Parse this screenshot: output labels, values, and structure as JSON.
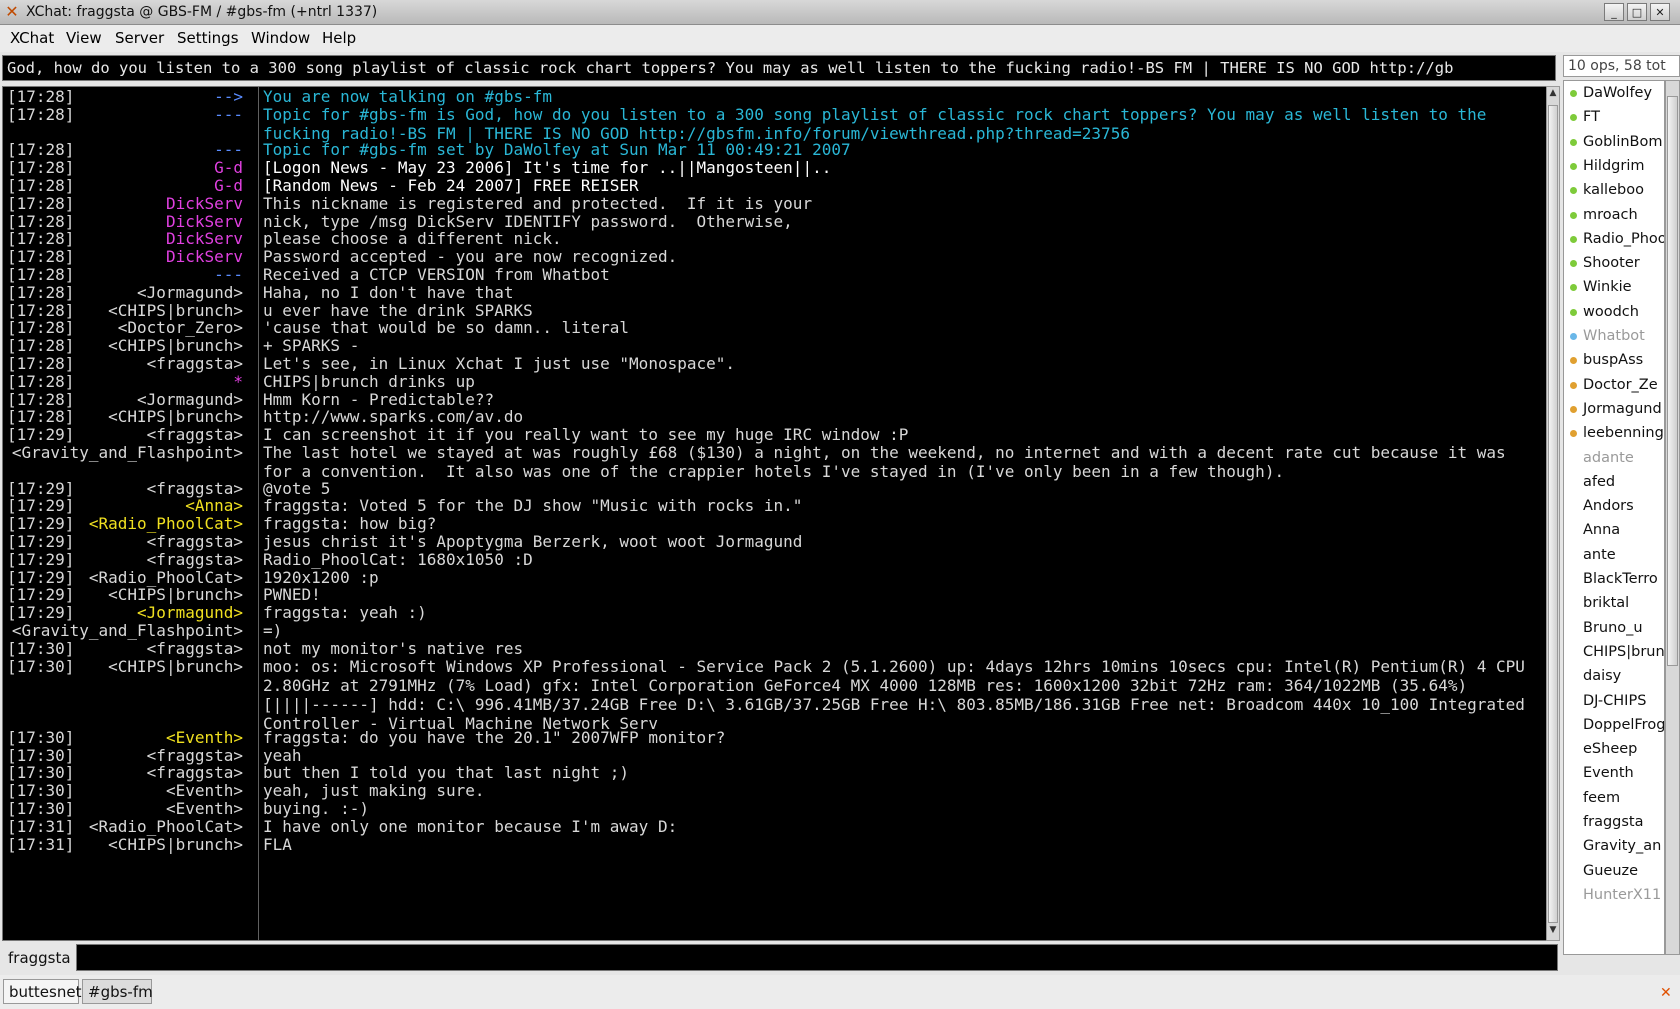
{
  "window": {
    "title": "XChat: fraggsta @ GBS-FM / #gbs-fm (+ntrl 1337)",
    "controls": [
      "_",
      "□",
      "✕"
    ]
  },
  "menu": [
    "XChat",
    "View",
    "Server",
    "Settings",
    "Window",
    "Help"
  ],
  "topic_bar": {
    "text": "God, how do you listen to a 300 song playlist of classic rock chart toppers? You may as well listen to the fucking radio!-BS FM | THERE IS NO GOD http://gb"
  },
  "user_list": {
    "header": "10 ops, 58 tot",
    "users": [
      {
        "name": "DaWolfey",
        "status": "op"
      },
      {
        "name": "FT",
        "status": "op"
      },
      {
        "name": "GoblinBom",
        "status": "op"
      },
      {
        "name": "Hildgrim",
        "status": "op"
      },
      {
        "name": "kalleboo",
        "status": "op"
      },
      {
        "name": "mroach",
        "status": "op"
      },
      {
        "name": "Radio_Phoo",
        "status": "op"
      },
      {
        "name": "Shooter",
        "status": "op"
      },
      {
        "name": "Winkie",
        "status": "op"
      },
      {
        "name": "woodch",
        "status": "op"
      },
      {
        "name": "Whatbot",
        "status": "halfop-away"
      },
      {
        "name": "buspAss",
        "status": "voice"
      },
      {
        "name": "Doctor_Ze",
        "status": "voice"
      },
      {
        "name": "Jormagund",
        "status": "voice"
      },
      {
        "name": "leebenning",
        "status": "voice"
      },
      {
        "name": "adante",
        "status": "away"
      },
      {
        "name": "afed",
        "status": "none"
      },
      {
        "name": "Andors",
        "status": "none"
      },
      {
        "name": "Anna",
        "status": "none"
      },
      {
        "name": "ante",
        "status": "none"
      },
      {
        "name": "BlackTerro",
        "status": "none"
      },
      {
        "name": "briktal",
        "status": "none"
      },
      {
        "name": "Bruno_u",
        "status": "none"
      },
      {
        "name": "CHIPS|brun",
        "status": "none"
      },
      {
        "name": "daisy",
        "status": "none"
      },
      {
        "name": "DJ-CHIPS",
        "status": "none"
      },
      {
        "name": "DoppelFrog",
        "status": "none"
      },
      {
        "name": "eSheep",
        "status": "none"
      },
      {
        "name": "Eventh",
        "status": "none"
      },
      {
        "name": "feem",
        "status": "none"
      },
      {
        "name": "fraggsta",
        "status": "none"
      },
      {
        "name": "Gravity_an",
        "status": "none"
      },
      {
        "name": "Gueuze",
        "status": "none"
      },
      {
        "name": "HunterX11",
        "status": "away"
      }
    ]
  },
  "colors": {
    "op": "#7ecb3a",
    "voice": "#e0a030",
    "halfop": "#6ab7e8",
    "away_text": "#9a9a9a",
    "chan": "#2ab7d6",
    "server": "#5a8cff",
    "magenta": "#e040e0",
    "yellow": "#f0e020",
    "highlight_bg": "#f0a000"
  },
  "chat": [
    {
      "ts": "[17:28]",
      "nick": "-->",
      "nc": "server",
      "msg": "You are now talking on #gbs-fm",
      "mc": "chan"
    },
    {
      "ts": "[17:28]",
      "nick": "---",
      "nc": "server",
      "msg": "Topic for #gbs-fm is God, how do you listen to a 300 song playlist of classic rock chart toppers? You may as well listen to the fucking radio!-BS FM | THERE IS NO GOD http://gbsfm.info/forum/viewthread.php?thread=23756",
      "mc": "chan",
      "rows": 2
    },
    {
      "ts": "[17:28]",
      "nick": "---",
      "nc": "server",
      "msg": "Topic for #gbs-fm set by DaWolfey at Sun Mar 11 00:49:21 2007",
      "mc": "chan"
    },
    {
      "ts": "[17:28]",
      "nick": "G-d",
      "nc": "magenta",
      "msg": "[Logon News - May 23 2006] It's time for ..||Mangosteen||..",
      "mc": "white"
    },
    {
      "ts": "[17:28]",
      "nick": "G-d",
      "nc": "magenta",
      "msg": "[Random News - Feb 24 2007] FREE REISER",
      "mc": "white"
    },
    {
      "ts": "[17:28]",
      "nick": "DickServ",
      "nc": "magenta",
      "msg": "This nickname is registered and protected.  If it is your"
    },
    {
      "ts": "[17:28]",
      "nick": "DickServ",
      "nc": "magenta",
      "msg": "nick, type /msg DickServ IDENTIFY password.  Otherwise,"
    },
    {
      "ts": "[17:28]",
      "nick": "DickServ",
      "nc": "magenta",
      "msg": "please choose a different nick."
    },
    {
      "ts": "[17:28]",
      "nick": "DickServ",
      "nc": "magenta",
      "msg": "Password accepted - you are now recognized."
    },
    {
      "ts": "[17:28]",
      "nick": "---",
      "nc": "server",
      "msg": "Received a CTCP VERSION from Whatbot"
    },
    {
      "ts": "[17:28]",
      "nick": "<Jormagund>",
      "nc": "plain",
      "msg": "Haha, no I don't have that"
    },
    {
      "ts": "[17:28]",
      "nick": "<CHIPS|brunch>",
      "nc": "plain",
      "msg": "u ever have the drink SPARKS"
    },
    {
      "ts": "[17:28]",
      "nick": "<Doctor_Zero>",
      "nc": "plain",
      "msg": "'cause that would be so damn.. literal"
    },
    {
      "ts": "[17:28]",
      "nick": "<CHIPS|brunch>",
      "nc": "plain",
      "msg": "+ SPARKS -"
    },
    {
      "ts": "[17:28]",
      "nick": "<fraggsta>",
      "nc": "plain",
      "msg": "Let's see, in Linux Xchat I just use \"Monospace\"."
    },
    {
      "ts": "[17:28]",
      "nick": "*",
      "nc": "magenta",
      "msg": "CHIPS|brunch drinks up"
    },
    {
      "ts": "[17:28]",
      "nick": "<Jormagund>",
      "nc": "plain",
      "msg": "Hmm Korn - Predictable??"
    },
    {
      "ts": "[17:28]",
      "nick": "<CHIPS|brunch>",
      "nc": "plain",
      "msg": "http://www.sparks.com/av.do"
    },
    {
      "ts": "[17:29]",
      "nick": "<fraggsta>",
      "nc": "plain",
      "msg": "I can screenshot it if you really want to see my huge IRC window :P"
    },
    {
      "ts": "",
      "nick": "<Gravity_and_Flashpoint>",
      "nc": "plain",
      "msg": "The last hotel we stayed at was roughly £68 ($130) a night, on the weekend, no internet and with a decent rate cut because it was for a convention.  It also was one of the crappier hotels I've stayed in (I've only been in a few though).",
      "rows": 2
    },
    {
      "ts": "[17:29]",
      "nick": "<fraggsta>",
      "nc": "plain",
      "msg": "@vote 5"
    },
    {
      "ts": "[17:29]",
      "nick": "<Anna>",
      "nc": "yellow",
      "msg": "fraggsta: Voted 5 for the DJ show \"Music with rocks in.\""
    },
    {
      "ts": "[17:29]",
      "nick": "<Radio_PhoolCat>",
      "nc": "yellow",
      "msg": "fraggsta: how big?"
    },
    {
      "ts": "[17:29]",
      "nick": "<fraggsta>",
      "nc": "plain",
      "msg": "jesus christ it's Apoptygma Berzerk, woot woot Jormagund"
    },
    {
      "ts": "[17:29]",
      "nick": "<fraggsta>",
      "nc": "plain",
      "msg": "Radio_PhoolCat: 1680x1050 :D"
    },
    {
      "ts": "[17:29]",
      "nick": "<Radio_PhoolCat>",
      "nc": "plain",
      "msg": "1920x1200 :p"
    },
    {
      "ts": "[17:29]",
      "nick": "<CHIPS|brunch>",
      "nc": "plain",
      "msg": "PWNED!"
    },
    {
      "ts": "[17:29]",
      "nick": "<Jormagund>",
      "nc": "yellow",
      "msg": "fraggsta: yeah :)"
    },
    {
      "ts": "",
      "nick": "<Gravity_and_Flashpoint>",
      "nc": "plain",
      "msg": "=)"
    },
    {
      "ts": "[17:30]",
      "nick": "<fraggsta>",
      "nc": "plain",
      "msg": "not my monitor's native res"
    },
    {
      "ts": "[17:30]",
      "nick": "<CHIPS|brunch>",
      "nc": "plain",
      "msg": "moo: os: Microsoft Windows XP Professional - Service Pack 2 (5.1.2600) up: 4days 12hrs 10mins 10secs cpu: Intel(R) Pentium(R) 4 CPU 2.80GHz at 2791MHz (7% Load) gfx: Intel Corporation GeForce4 MX 4000 128MB res: 1600x1200 32bit 72Hz ram: 364/1022MB (35.64%) [||||------] hdd: C:\\ 996.41MB/37.24GB Free D:\\ 3.61GB/37.25GB Free H:\\ 803.85MB/186.31GB Free net: Broadcom 440x 10_100 Integrated Controller - Virtual Machine Network Serv",
      "rows": 4
    },
    {
      "ts": "[17:30]",
      "nick": "<Eventh>",
      "nc": "yellow",
      "msg": "fraggsta: do you have the 20.1\" 2007WFP monitor?"
    },
    {
      "ts": "[17:30]",
      "nick": "<fraggsta>",
      "nc": "plain",
      "msg": "yeah"
    },
    {
      "ts": "[17:30]",
      "nick": "<fraggsta>",
      "nc": "plain",
      "msg": "but then I told you that last night ;)"
    },
    {
      "ts": "[17:30]",
      "nick": "<Eventh>",
      "nc": "plain",
      "msg": "yeah, just making sure."
    },
    {
      "ts": "[17:30]",
      "nick": "<Eventh>",
      "nc": "plain",
      "msg": "buying. :-)"
    },
    {
      "ts": "[17:31]",
      "nick": "<Radio_PhoolCat>",
      "nc": "plain",
      "msg": "I have only one monitor because I'm away D:"
    },
    {
      "ts": "[17:31]",
      "nick": "<CHIPS|brunch>",
      "nc": "plain",
      "msg": "FLA"
    }
  ],
  "input": {
    "nick": "fraggsta",
    "value": ""
  },
  "tabs": [
    "buttesnet",
    "#gbs-fm"
  ]
}
